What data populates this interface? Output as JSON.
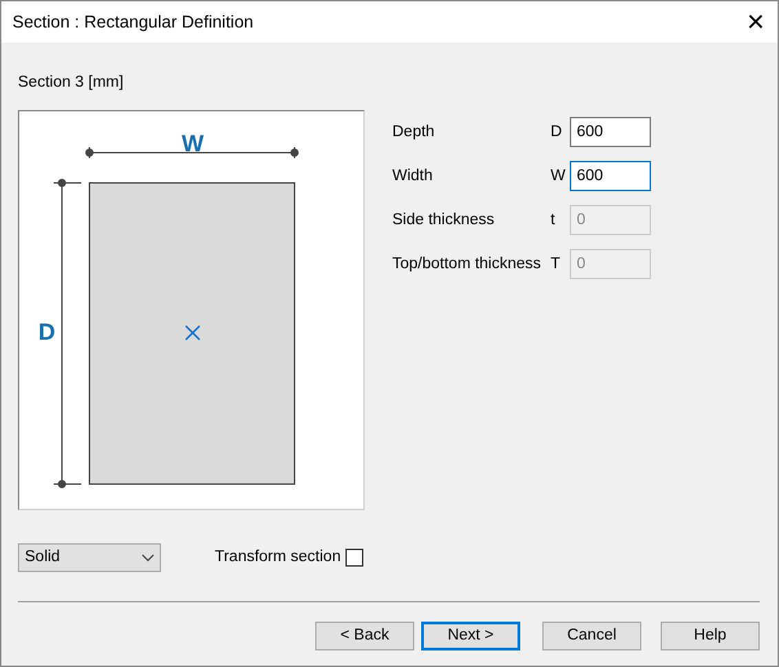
{
  "window": {
    "title": "Section : Rectangular Definition",
    "close": "×"
  },
  "section_label": "Section 3  [mm]",
  "diagram": {
    "width_label": "W",
    "depth_label": "D"
  },
  "fields": [
    {
      "label": "Depth",
      "symbol": "D",
      "value": "600",
      "disabled": false,
      "focused": false
    },
    {
      "label": "Width",
      "symbol": "W",
      "value": "600",
      "disabled": false,
      "focused": true
    },
    {
      "label": "Side thickness",
      "symbol": "t",
      "value": "0",
      "disabled": true,
      "focused": false
    },
    {
      "label": "Top/bottom thickness",
      "symbol": "T",
      "value": "0",
      "disabled": true,
      "focused": false
    }
  ],
  "type_dropdown": {
    "value": "Solid"
  },
  "transform": {
    "label": "Transform section",
    "checked": false
  },
  "buttons": [
    {
      "label": "< Back",
      "default": false
    },
    {
      "label": "Next >",
      "default": true
    },
    {
      "label": "Cancel",
      "default": false
    },
    {
      "label": "Help",
      "default": false
    }
  ]
}
